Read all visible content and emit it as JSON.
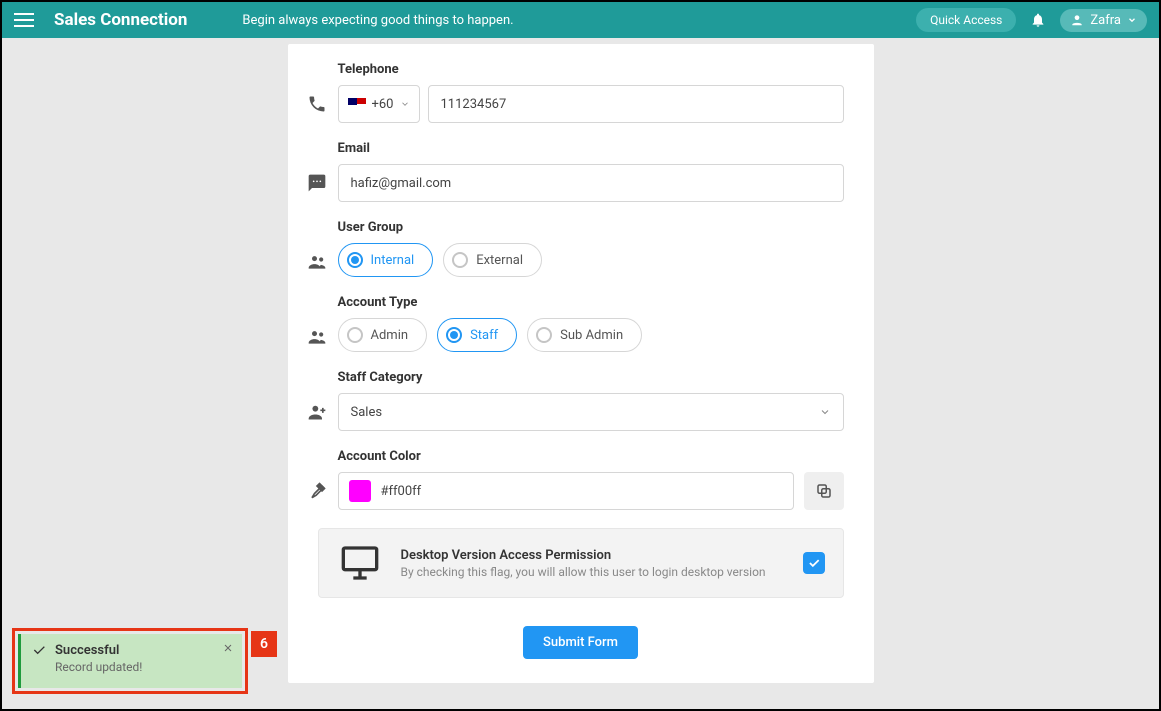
{
  "header": {
    "brand": "Sales Connection",
    "tagline": "Begin always expecting good things to happen.",
    "quick_access": "Quick Access",
    "user": "Zafra"
  },
  "form": {
    "telephone": {
      "label": "Telephone",
      "code": "+60",
      "value": "111234567"
    },
    "email": {
      "label": "Email",
      "value": "hafiz@gmail.com"
    },
    "user_group": {
      "label": "User Group",
      "opts": [
        "Internal",
        "External"
      ],
      "selected": "Internal"
    },
    "account_type": {
      "label": "Account Type",
      "opts": [
        "Admin",
        "Staff",
        "Sub Admin"
      ],
      "selected": "Staff"
    },
    "staff_category": {
      "label": "Staff Category",
      "value": "Sales"
    },
    "account_color": {
      "label": "Account Color",
      "value": "#ff00ff",
      "swatch": "#ff00ff"
    },
    "permission": {
      "title": "Desktop Version Access Permission",
      "desc": "By checking this flag, you will allow this user to login desktop version",
      "checked": true
    },
    "submit": "Submit Form"
  },
  "toast": {
    "title": "Successful",
    "message": "Record updated!"
  },
  "callout": "6"
}
